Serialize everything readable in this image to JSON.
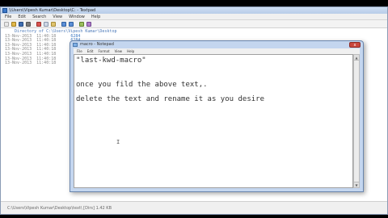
{
  "background_window": {
    "title": "\\\\Users\\Vipesh Kumar\\Desktop\\C: - Textpad",
    "menu": [
      "File",
      "Edit",
      "Search",
      "View",
      "Window",
      "Help"
    ],
    "listing_title": "    Directory of C:\\Users\\Vipesh Kumar\\Desktop",
    "listing": [
      {
        "date": "13-Nov-2013",
        "time": "11:40:18",
        "size": "6284"
      },
      {
        "date": "13-Nov-2013",
        "time": "11:40:18",
        "size": "6284"
      },
      {
        "date": "13-Nov-2013",
        "time": "11:40:18",
        "size": "6284"
      },
      {
        "date": "13-Nov-2013",
        "time": "11:40:18",
        "size": "6284"
      },
      {
        "date": "13-Nov-2013",
        "time": "11:40:18",
        "size": ""
      },
      {
        "date": "13-Nov-2013",
        "time": "11:40:18",
        "size": ""
      },
      {
        "date": "13-Nov-2013",
        "time": "11:40:18",
        "size": ""
      }
    ],
    "status": "C:\\Users\\Vipesh Kumar\\Desktop\\text\\  [Dirs]  1.42 KB"
  },
  "notepad": {
    "title": "macro - Notepad",
    "menu": [
      "File",
      "Edit",
      "Format",
      "View",
      "Help"
    ],
    "lines": [
      "\"last-kwd-macro\"",
      "once you fild the above text,.",
      "delete the text and rename it as you desire"
    ],
    "close_label": "x"
  }
}
